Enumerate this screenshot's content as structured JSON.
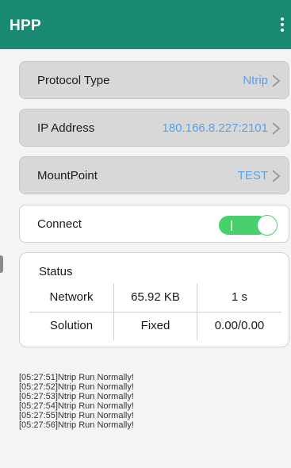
{
  "app": {
    "title": "HPP"
  },
  "settings": {
    "protocol_type": {
      "label": "Protocol Type",
      "value": "Ntrip"
    },
    "ip_address": {
      "label": "IP Address",
      "value": "180.166.8.227:2101"
    },
    "mountpoint": {
      "label": "MountPoint",
      "value": "TEST"
    }
  },
  "connect": {
    "label": "Connect",
    "enabled": true
  },
  "status": {
    "title": "Status",
    "rows": [
      {
        "name": "Network",
        "value": "65.92 KB",
        "extra": "1 s"
      },
      {
        "name": "Solution",
        "value": "Fixed",
        "extra": "0.00/0.00"
      }
    ]
  },
  "log": [
    "[05:27:51]Ntrip Run Normally!",
    "[05:27:52]Ntrip Run Normally!",
    "[05:27:53]Ntrip Run Normally!",
    "[05:27:54]Ntrip Run Normally!",
    "[05:27:55]Ntrip Run Normally!",
    "[05:27:56]Ntrip Run Normally!"
  ],
  "icons": {
    "menu": "more-vertical-icon",
    "chevron": "chevron-right-icon"
  },
  "colors": {
    "appbar": "#1b8a73",
    "accent_value": "#5aa0e6",
    "toggle_on": "#47d06b"
  }
}
